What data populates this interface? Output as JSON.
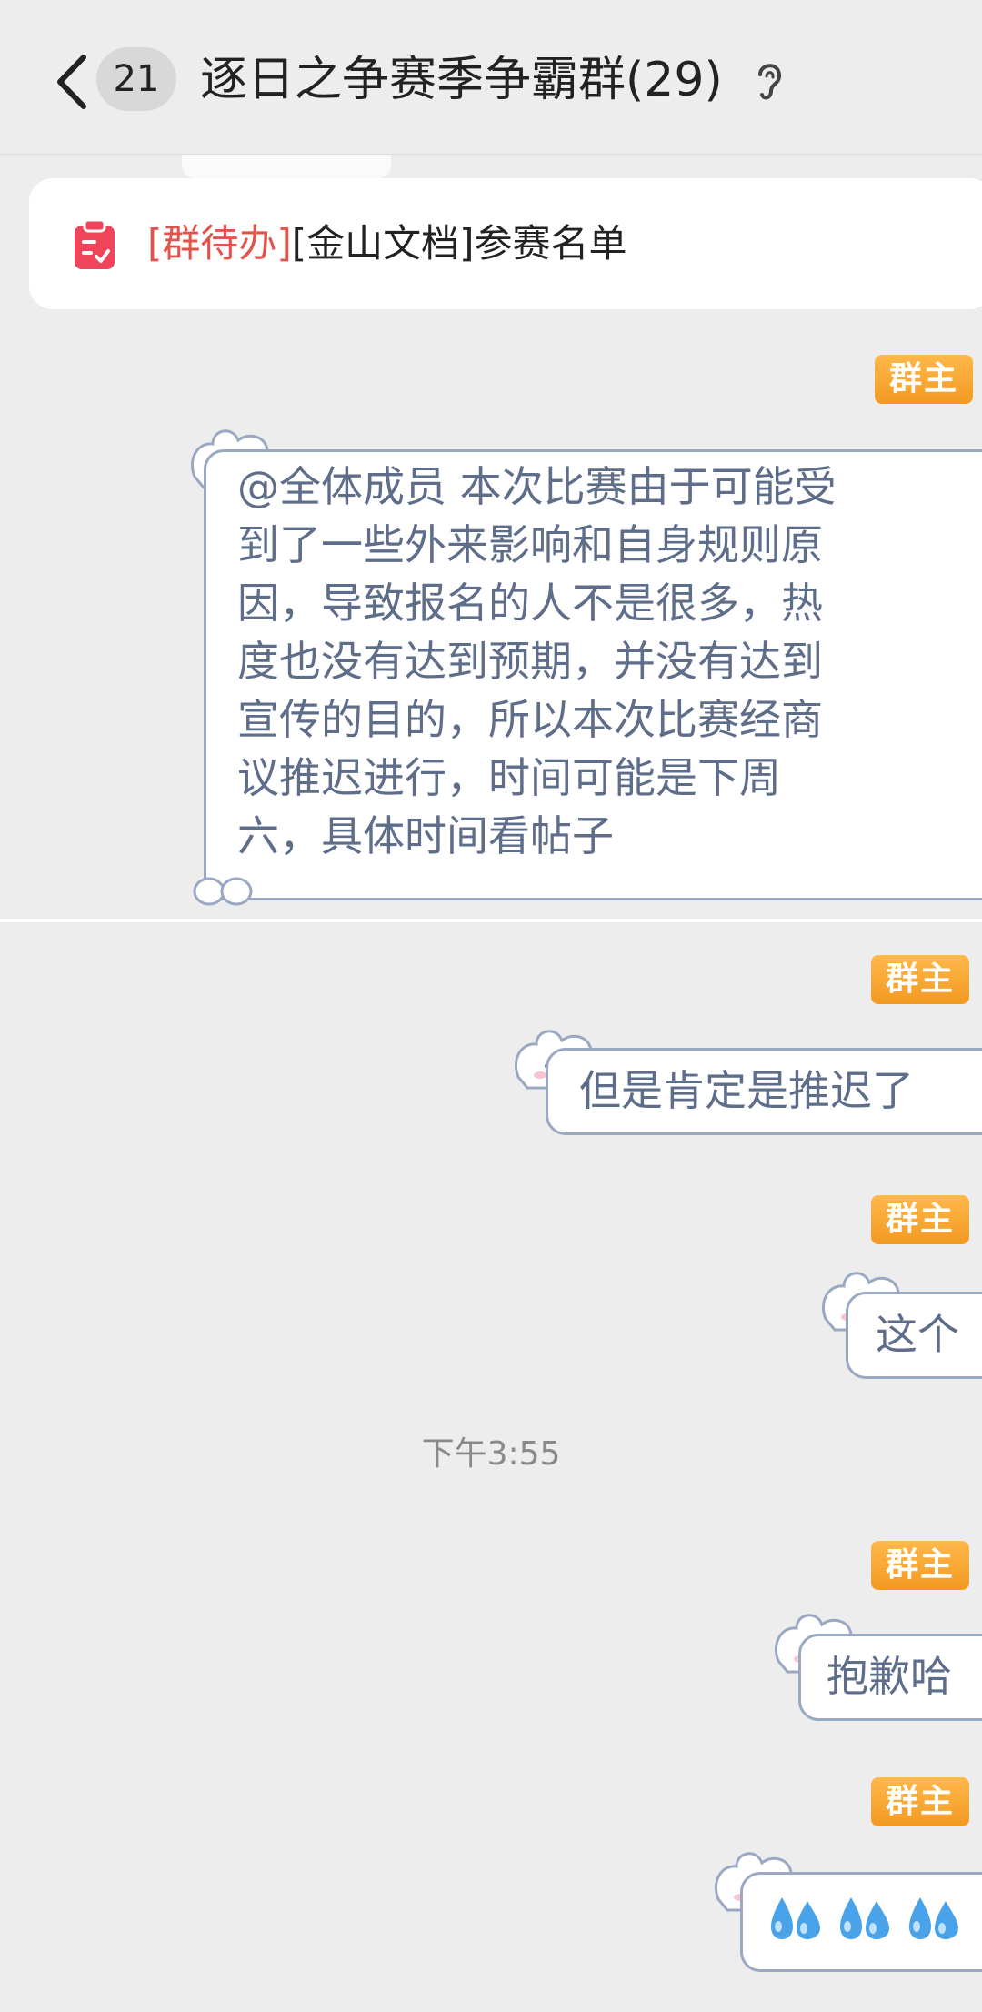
{
  "header": {
    "back_icon": "chevron-left-icon",
    "unread_count": "21",
    "title": "逐日之争赛季争霸群(29)",
    "ear_icon": "ear-icon"
  },
  "todo": {
    "icon": "clipboard-icon",
    "tag": "[群待办]",
    "text": "[金山文档]参赛名单"
  },
  "messages": [
    {
      "role": "群主",
      "text": "@全体成员 本次比赛由于可能受\n到了一些外来影响和自身规则原\n因，导致报名的人不是很多，热\n度也没有达到预期，并没有达到\n宣传的目的，所以本次比赛经商\n议推迟进行，时间可能是下周\n六，具体时间看帖子"
    },
    {
      "role": "群主",
      "text": "但是肯定是推迟了"
    },
    {
      "role": "群主",
      "text": "这个"
    },
    {
      "role": "群主",
      "text": "抱歉哈"
    },
    {
      "role": "群主",
      "text": "",
      "emoji": "sweat-drops-icon"
    }
  ],
  "timestamp": "下午3:55",
  "colors": {
    "background": "#ededed",
    "badge": "#f29a22",
    "todo_tag": "#e1544c",
    "bubble_text": "#5e6d8a",
    "bubble_border": "#9aa8c2"
  }
}
